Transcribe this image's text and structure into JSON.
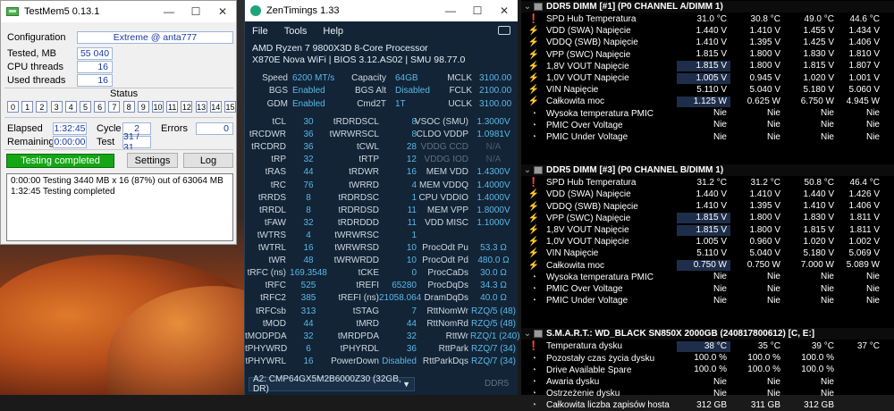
{
  "testmem": {
    "title": "TestMem5  0.13.1",
    "configuration_label": "Configuration",
    "configuration_value": "Extreme @ anta777",
    "tested_label": "Tested, MB",
    "tested_value": "55 040",
    "cpu_threads_label": "CPU threads",
    "cpu_threads_value": "16",
    "used_threads_label": "Used threads",
    "used_threads_value": "16",
    "status_label": "Status",
    "tests": [
      "0",
      "1",
      "2",
      "3",
      "4",
      "5",
      "6",
      "7",
      "8",
      "9",
      "10",
      "11",
      "12",
      "13",
      "14",
      "15"
    ],
    "elapsed_label": "Elapsed",
    "elapsed_value": "1:32:45",
    "cycle_label": "Cycle",
    "cycle_value": "2",
    "errors_label": "Errors",
    "errors_value": "0",
    "remaining_label": "Remaining",
    "remaining_value": "0:00:00",
    "test_label": "Test",
    "test_value": "31 / 31",
    "status_text": "Testing completed",
    "settings_label": "Settings",
    "log_label": "Log",
    "log_lines": [
      "0:00:00  Testing 3440 MB x 16 (87%) out of 63064 MB",
      "1:32:45  Testing completed"
    ]
  },
  "zen": {
    "title": "ZenTimings 1.33",
    "menu": [
      "File",
      "Tools",
      "Help"
    ],
    "cpu": "AMD Ryzen 7 9800X3D 8-Core Processor",
    "board": "X870E Nova WiFi | BIOS 3.12.AS02 | SMU 98.77.0",
    "summary": [
      {
        "l1": "Speed",
        "v1": "6200 MT/s",
        "l2": "Capacity",
        "v2": "64GB",
        "l3": "MCLK",
        "v3": "3100.00"
      },
      {
        "l1": "BGS",
        "v1": "Enabled",
        "l2": "BGS Alt",
        "v2": "Disabled",
        "l3": "FCLK",
        "v3": "2100.00"
      },
      {
        "l1": "GDM",
        "v1": "Enabled",
        "l2": "Cmd2T",
        "v2": "1T",
        "l3": "UCLK",
        "v3": "3100.00"
      }
    ],
    "timings": [
      {
        "l1": "tCL",
        "v1": "30",
        "l2": "tRDRDSCL",
        "v2": "8",
        "l3": "VSOC (SMU)",
        "v3": "1.3000V"
      },
      {
        "l1": "tRCDWR",
        "v1": "36",
        "l2": "tWRWRSCL",
        "v2": "8",
        "l3": "CLDO VDDP",
        "v3": "1.0981V"
      },
      {
        "l1": "tRCDRD",
        "v1": "36",
        "l2": "tCWL",
        "v2": "28",
        "l3": "VDDG CCD",
        "v3": "N/A"
      },
      {
        "l1": "tRP",
        "v1": "32",
        "l2": "tRTP",
        "v2": "12",
        "l3": "VDDG IOD",
        "v3": "N/A"
      },
      {
        "l1": "tRAS",
        "v1": "44",
        "l2": "tRDWR",
        "v2": "16",
        "l3": "MEM VDD",
        "v3": "1.4300V"
      },
      {
        "l1": "tRC",
        "v1": "76",
        "l2": "tWRRD",
        "v2": "4",
        "l3": "MEM VDDQ",
        "v3": "1.4000V"
      },
      {
        "l1": "tRRDS",
        "v1": "8",
        "l2": "tRDRDSC",
        "v2": "1",
        "l3": "CPU VDDIO",
        "v3": "1.4000V"
      },
      {
        "l1": "tRRDL",
        "v1": "8",
        "l2": "tRDRDSD",
        "v2": "11",
        "l3": "MEM VPP",
        "v3": "1.8000V"
      },
      {
        "l1": "tFAW",
        "v1": "32",
        "l2": "tRDRDDD",
        "v2": "11",
        "l3": "VDD MISC",
        "v3": "1.1000V"
      },
      {
        "l1": "tWTRS",
        "v1": "4",
        "l2": "tWRWRSC",
        "v2": "1",
        "l3": "",
        "v3": ""
      },
      {
        "l1": "tWTRL",
        "v1": "16",
        "l2": "tWRWRSD",
        "v2": "10",
        "l3": "ProcOdt Pu",
        "v3": "53.3 Ω"
      },
      {
        "l1": "tWR",
        "v1": "48",
        "l2": "tWRWRDD",
        "v2": "10",
        "l3": "ProcOdt Pd",
        "v3": "480.0 Ω"
      },
      {
        "l1": "tRFC (ns)",
        "v1": "169.3548",
        "l2": "tCKE",
        "v2": "0",
        "l3": "ProcCaDs",
        "v3": "30.0 Ω"
      },
      {
        "l1": "tRFC",
        "v1": "525",
        "l2": "tREFI",
        "v2": "65280",
        "l3": "ProcDqDs",
        "v3": "34.3 Ω"
      },
      {
        "l1": "tRFC2",
        "v1": "385",
        "l2": "tREFI (ns)",
        "v2": "21058.064",
        "l3": "DramDqDs",
        "v3": "40.0 Ω"
      },
      {
        "l1": "tRFCsb",
        "v1": "313",
        "l2": "tSTAG",
        "v2": "7",
        "l3": "RttNomWr",
        "v3": "RZQ/5 (48)"
      },
      {
        "l1": "tMOD",
        "v1": "44",
        "l2": "tMRD",
        "v2": "44",
        "l3": "RttNomRd",
        "v3": "RZQ/5 (48)"
      },
      {
        "l1": "tMODPDA",
        "v1": "32",
        "l2": "tMRDPDA",
        "v2": "32",
        "l3": "RttWr",
        "v3": "RZQ/1 (240)"
      },
      {
        "l1": "tPHYWRD",
        "v1": "6",
        "l2": "tPHYRDL",
        "v2": "36",
        "l3": "RttPark",
        "v3": "RZQ/7 (34)"
      },
      {
        "l1": "tPHYWRL",
        "v1": "16",
        "l2": "PowerDown",
        "v2": "Disabled",
        "l3": "RttParkDqs",
        "v3": "RZQ/7 (34)"
      }
    ],
    "module": "A2: CMP64GX5M2B6000Z30 (32GB, DR)",
    "ddr": "DDR5"
  },
  "hwinfo": {
    "sections": [
      {
        "title": "DDR5 DIMM [#1] (P0 CHANNEL A/DIMM 1)",
        "rows": [
          {
            "icon": "thermometer",
            "name": "SPD Hub Temperatura",
            "c1": "31.0 °C",
            "c2": "30.8 °C",
            "c3": "49.0 °C",
            "c4": "44.6 °C"
          },
          {
            "icon": "bolt",
            "name": "VDD (SWA) Napięcie",
            "c1": "1.440 V",
            "c2": "1.410 V",
            "c3": "1.455 V",
            "c4": "1.434 V"
          },
          {
            "icon": "bolt",
            "name": "VDDQ (SWB) Napięcie",
            "c1": "1.410 V",
            "c2": "1.395 V",
            "c3": "1.425 V",
            "c4": "1.406 V"
          },
          {
            "icon": "bolt",
            "name": "VPP (SWC) Napięcie",
            "c1": "1.815 V",
            "c2": "1.800 V",
            "c3": "1.830 V",
            "c4": "1.810 V"
          },
          {
            "icon": "bolt",
            "name": "1,8V VOUT Napięcie",
            "c1": "1.815 V",
            "c2": "1.800 V",
            "c3": "1.815 V",
            "c4": "1.807 V",
            "hl": true
          },
          {
            "icon": "bolt",
            "name": "1,0V VOUT Napięcie",
            "c1": "1.005 V",
            "c2": "0.945 V",
            "c3": "1.020 V",
            "c4": "1.001 V",
            "hl": true
          },
          {
            "icon": "bolt",
            "name": "VIN Napięcie",
            "c1": "5.110 V",
            "c2": "5.040 V",
            "c3": "5.180 V",
            "c4": "5.060 V"
          },
          {
            "icon": "bolt",
            "name": "Całkowita moc",
            "c1": "1.125 W",
            "c2": "0.625 W",
            "c3": "6.750 W",
            "c4": "4.945 W",
            "hl": true
          },
          {
            "icon": "clock",
            "name": "Wysoka temperatura PMIC",
            "c1": "Nie",
            "c2": "Nie",
            "c3": "Nie",
            "c4": "Nie"
          },
          {
            "icon": "clock",
            "name": "PMIC Over Voltage",
            "c1": "Nie",
            "c2": "Nie",
            "c3": "Nie",
            "c4": "Nie"
          },
          {
            "icon": "clock",
            "name": "PMIC Under Voltage",
            "c1": "Nie",
            "c2": "Nie",
            "c3": "Nie",
            "c4": "Nie"
          }
        ]
      },
      {
        "title": "DDR5 DIMM [#3] (P0 CHANNEL B/DIMM 1)",
        "rows": [
          {
            "icon": "thermometer",
            "name": "SPD Hub Temperatura",
            "c1": "31.2 °C",
            "c2": "31.2 °C",
            "c3": "50.8 °C",
            "c4": "46.4 °C"
          },
          {
            "icon": "bolt",
            "name": "VDD (SWA) Napięcie",
            "c1": "1.440 V",
            "c2": "1.410 V",
            "c3": "1.440 V",
            "c4": "1.426 V"
          },
          {
            "icon": "bolt",
            "name": "VDDQ (SWB) Napięcie",
            "c1": "1.410 V",
            "c2": "1.395 V",
            "c3": "1.410 V",
            "c4": "1.406 V"
          },
          {
            "icon": "bolt",
            "name": "VPP (SWC) Napięcie",
            "c1": "1.815 V",
            "c2": "1.800 V",
            "c3": "1.830 V",
            "c4": "1.811 V",
            "hl": true
          },
          {
            "icon": "bolt",
            "name": "1,8V VOUT Napięcie",
            "c1": "1.815 V",
            "c2": "1.800 V",
            "c3": "1.815 V",
            "c4": "1.811 V",
            "hl": true
          },
          {
            "icon": "bolt",
            "name": "1,0V VOUT Napięcie",
            "c1": "1.005 V",
            "c2": "0.960 V",
            "c3": "1.020 V",
            "c4": "1.002 V"
          },
          {
            "icon": "bolt",
            "name": "VIN Napięcie",
            "c1": "5.110 V",
            "c2": "5.040 V",
            "c3": "5.180 V",
            "c4": "5.069 V"
          },
          {
            "icon": "bolt",
            "name": "Całkowita moc",
            "c1": "0.750 W",
            "c2": "0.750 W",
            "c3": "7.000 W",
            "c4": "5.089 W",
            "hl": true
          },
          {
            "icon": "clock",
            "name": "Wysoka temperatura PMIC",
            "c1": "Nie",
            "c2": "Nie",
            "c3": "Nie",
            "c4": "Nie"
          },
          {
            "icon": "clock",
            "name": "PMIC Over Voltage",
            "c1": "Nie",
            "c2": "Nie",
            "c3": "Nie",
            "c4": "Nie"
          },
          {
            "icon": "clock",
            "name": "PMIC Under Voltage",
            "c1": "Nie",
            "c2": "Nie",
            "c3": "Nie",
            "c4": "Nie"
          }
        ]
      },
      {
        "title": "S.M.A.R.T.: WD_BLACK SN850X 2000GB (240817800612) [C, E:]",
        "rows": [
          {
            "icon": "thermometer",
            "name": "Temperatura dysku",
            "c1": "38 °C",
            "c2": "35 °C",
            "c3": "39 °C",
            "c4": "37 °C",
            "hl": true
          },
          {
            "icon": "clock",
            "name": "Pozostały czas życia dysku",
            "c1": "100.0 %",
            "c2": "100.0 %",
            "c3": "100.0 %",
            "c4": ""
          },
          {
            "icon": "clock",
            "name": "Drive Available Spare",
            "c1": "100.0 %",
            "c2": "100.0 %",
            "c3": "100.0 %",
            "c4": ""
          },
          {
            "icon": "clock",
            "name": "Awaria dysku",
            "c1": "Nie",
            "c2": "Nie",
            "c3": "Nie",
            "c4": ""
          },
          {
            "icon": "clock",
            "name": "Ostrzeżenie dysku",
            "c1": "Nie",
            "c2": "Nie",
            "c3": "Nie",
            "c4": ""
          },
          {
            "icon": "clock",
            "name": "Całkowita liczba zapisów hosta",
            "c1": "312 GB",
            "c2": "311 GB",
            "c3": "312 GB",
            "c4": ""
          }
        ]
      }
    ]
  }
}
